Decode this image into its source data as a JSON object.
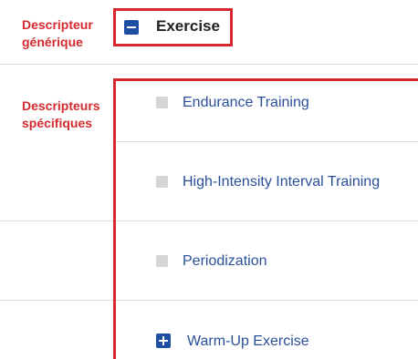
{
  "labels": {
    "generic": "Descripteur générique",
    "specific": "Descripteurs spécifiques"
  },
  "generic_term": {
    "label": "Exercise",
    "toggle": "minus-icon"
  },
  "specific_terms": [
    {
      "label": "Endurance Training",
      "marker": "leaf-square-icon"
    },
    {
      "label": "High-Intensity Interval Training",
      "marker": "leaf-square-icon"
    },
    {
      "label": "Periodization",
      "marker": "leaf-square-icon"
    },
    {
      "label": "Warm-Up Exercise",
      "marker": "plus-icon"
    }
  ],
  "colors": {
    "annotation_red": "#d42a2f",
    "toggle_blue": "#1f4fa3",
    "link_blue": "#2a4f9a",
    "leaf_gray": "#d6d6d6"
  }
}
